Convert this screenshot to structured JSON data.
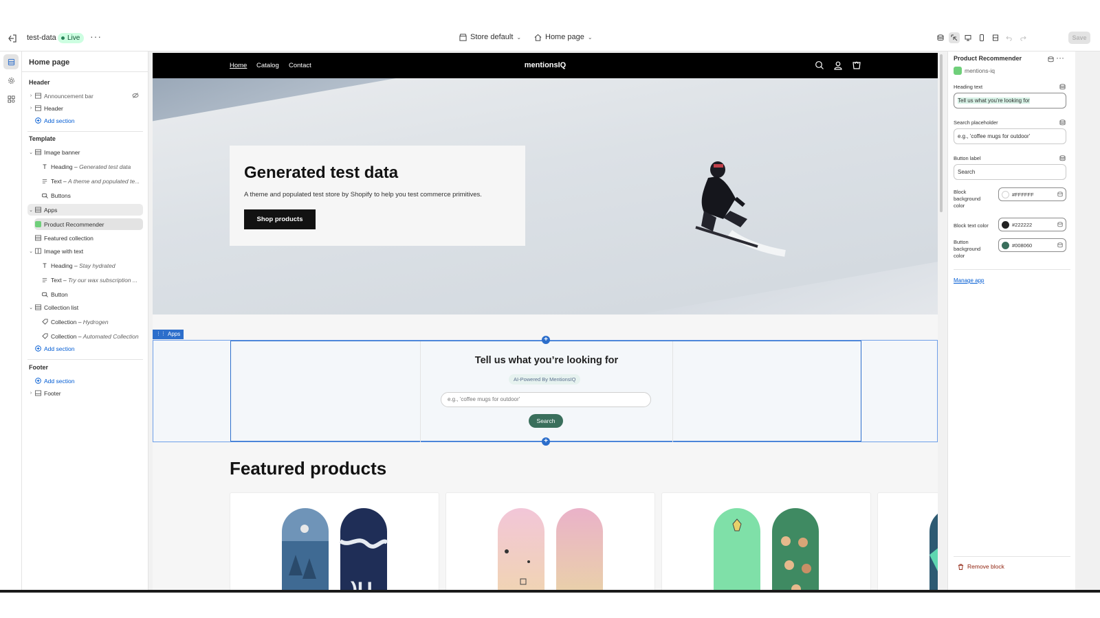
{
  "topbar": {
    "store": "test-data",
    "status": "Live",
    "theme_select": "Store default",
    "page_select": "Home page",
    "save": "Save"
  },
  "left": {
    "title": "Home page",
    "header_group": "Header",
    "header_items": [
      "Announcement bar",
      "Header"
    ],
    "add_section": "Add section",
    "template_group": "Template",
    "image_banner": "Image banner",
    "banner_blocks": [
      {
        "label": "Heading",
        "detail": "Generated test data"
      },
      {
        "label": "Text",
        "detail": "A theme and populated te..."
      },
      {
        "label": "Buttons",
        "detail": ""
      }
    ],
    "apps": "Apps",
    "product_recommender": "Product Recommender",
    "featured_collection": "Featured collection",
    "image_with_text": "Image with text",
    "iwt_blocks": [
      {
        "label": "Heading",
        "detail": "Stay hydrated"
      },
      {
        "label": "Text",
        "detail": "Try our wax subscription ..."
      },
      {
        "label": "Button",
        "detail": ""
      }
    ],
    "collection_list": "Collection list",
    "collection_blocks": [
      {
        "label": "Collection",
        "detail": "Hydrogen"
      },
      {
        "label": "Collection",
        "detail": "Automated Collection"
      }
    ],
    "footer_group": "Footer",
    "footer_item": "Footer"
  },
  "preview": {
    "nav_links": [
      "Home",
      "Catalog",
      "Contact"
    ],
    "brand": "mentionsIQ",
    "hero_heading": "Generated test data",
    "hero_text": "A theme and populated test store by Shopify to help you test commerce primitives.",
    "hero_button": "Shop products",
    "apps_tag": "Apps",
    "rec_heading": "Tell us what you’re looking for",
    "rec_badge": "AI-Powered By MentionsIQ",
    "rec_placeholder": "e.g., 'coffee mugs for outdoor'",
    "rec_button": "Search",
    "featured_title": "Featured products"
  },
  "right": {
    "title": "Product Recommender",
    "app_name": "mentions-iq",
    "heading_label": "Heading text",
    "heading_value": "Tell us what you're looking for",
    "placeholder_label": "Search placeholder",
    "placeholder_value": "e.g., 'coffee mugs for outdoor'",
    "button_label_label": "Button label",
    "button_label_value": "Search",
    "block_bg_label": "Block background color",
    "block_bg_value": "#FFFFFF",
    "block_text_label": "Block text color",
    "block_text_value": "#222222",
    "button_bg_label": "Button background color",
    "button_bg_value": "#008060",
    "manage": "Manage app",
    "remove": "Remove block"
  },
  "colors": {
    "accent_blue": "#2c6ecb",
    "link_blue": "#005bd3",
    "recommender_button": "#3a6f5c",
    "block_text": "#222222",
    "button_bg": "#008060"
  }
}
